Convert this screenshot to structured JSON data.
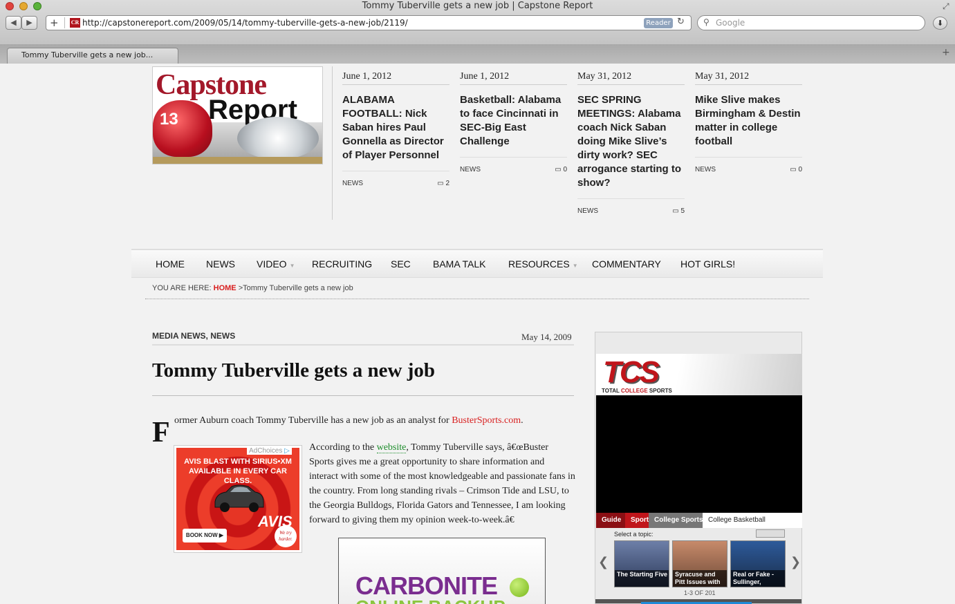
{
  "browser": {
    "window_title": "Tommy Tuberville gets a new job | Capstone Report",
    "url": "http://capstonereport.com/2009/05/14/tommy-tuberville-gets-a-new-job/2119/",
    "favicon_text": "CR",
    "reader_label": "Reader",
    "search_placeholder": "Google",
    "tab_title": "Tommy Tuberville gets a new job...",
    "add_symbol": "+",
    "back_symbol": "◀",
    "forward_symbol": "▶",
    "reload_symbol": "↻",
    "new_tab_symbol": "+"
  },
  "site": {
    "logo_line1": "Capstone",
    "logo_line2": "Report",
    "logo_helmet_number": "13"
  },
  "stories": [
    {
      "date": "June 1, 2012",
      "title": "ALABAMA FOOTBALL: Nick Saban hires Paul Gonnella as Director of Player Personnel",
      "category": "NEWS",
      "comments": "2"
    },
    {
      "date": "June 1, 2012",
      "title": "Basketball: Alabama to face Cincinnati in SEC-Big East Challenge",
      "category": "NEWS",
      "comments": "0"
    },
    {
      "date": "May 31, 2012",
      "title": "SEC SPRING MEETINGS: Alabama coach Nick Saban doing Mike Slive’s dirty work? SEC arrogance starting to show?",
      "category": "NEWS",
      "comments": "5"
    },
    {
      "date": "May 31, 2012",
      "title": "Mike Slive makes Birmingham & Destin matter in college football",
      "category": "NEWS",
      "comments": "0"
    }
  ],
  "nav": [
    "HOME",
    "NEWS",
    "VIDEO",
    "RECRUITING",
    "SEC",
    "BAMA TALK",
    "RESOURCES",
    "COMMENTARY",
    "HOT GIRLS!"
  ],
  "breadcrumb": {
    "prefix": "YOU ARE HERE:",
    "home": "HOME",
    "separator": ">",
    "current": "Tommy Tuberville gets a new job"
  },
  "article": {
    "categories": "MEDIA NEWS, NEWS",
    "date": "May 14, 2009",
    "title": "Tommy Tuberville gets a new job",
    "dropcap": "F",
    "para1_text": "ormer Auburn coach Tommy Tuberville has a new job as an analyst for ",
    "para1_link": "BusterSports.com",
    "para1_end": ".",
    "para2_start": "According to the ",
    "para2_link": "website",
    "para2_text": ", Tommy Tuberville says, â€œBuster Sports gives me a great opportunity to share information and interact with some of the most knowledgeable and passionate fans in the country. From long standing rivals – Crimson Tide and LSU, to the Georgia Bulldogs, Florida Gators and Tennessee, I am looking forward to giving them my opinion week-to-week.â€"
  },
  "ads": {
    "adchoices": "AdChoices",
    "avis_headline": "AVIS BLAST WITH SIRIUS•XM AVAILABLE IN EVERY CAR CLASS.",
    "avis_logo": "AVIS",
    "avis_button": "BOOK NOW ▶",
    "avis_badge": "We try harder.",
    "carbonite_name": "CARBONITE",
    "carbonite_sub": "ONLINE BACKUP"
  },
  "video_widget": {
    "logo": "TCS",
    "tagline_pre": "TOTAL ",
    "tagline_accent": "COLLEGE",
    "tagline_post": " SPORTS",
    "tabs": [
      "Guide",
      "Sport",
      "College Sports",
      "College Basketball"
    ],
    "topic_label": "Select a topic:",
    "thumbs": [
      "The Starting Five",
      "Syracuse and Pitt Issues with",
      "Real or Fake - Sullinger,"
    ],
    "count": "1-3 OF 201",
    "prev": "❮",
    "next": "❯"
  },
  "colors": {
    "accent_red": "#d81e1e",
    "link_green": "#1d8d2b",
    "tcs_red": "#c0151b"
  }
}
